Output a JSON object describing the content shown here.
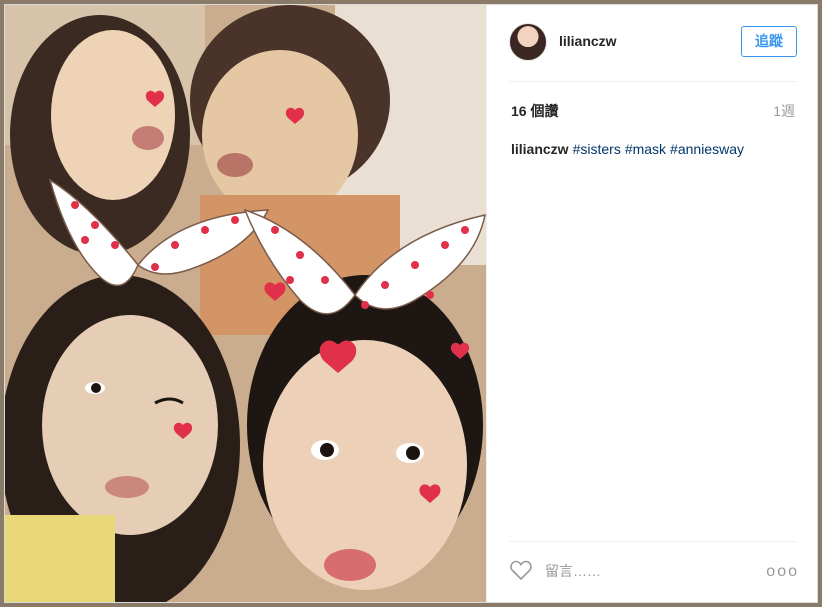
{
  "post": {
    "photo_alt_icon": "selfie-photo",
    "author": {
      "username": "lilianczw",
      "avatar_icon": "avatar-icon"
    },
    "follow_label": "追蹤",
    "likes": "16 個讚",
    "time_ago": "1週",
    "caption": {
      "username": "lilianczw",
      "hashtags": [
        "#sisters",
        "#mask",
        "#anniesway"
      ]
    },
    "comment_placeholder": "留言……",
    "more_label": "ooo"
  },
  "colors": {
    "accent": "#3897f0",
    "hashtag": "#003569",
    "muted": "#999999",
    "text": "#262626",
    "heart": "#e0304a"
  }
}
